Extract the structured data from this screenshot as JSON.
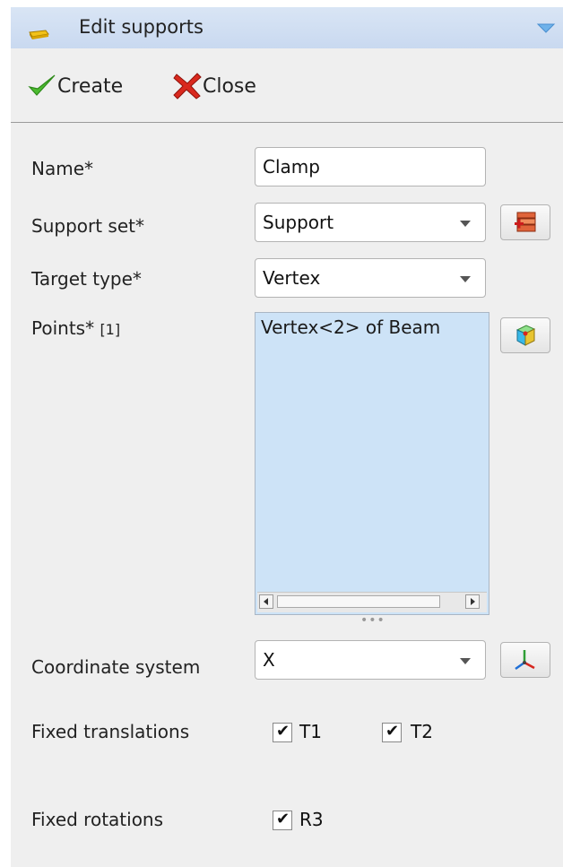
{
  "titlebar": {
    "title": "Edit supports"
  },
  "toolbar": {
    "create_label": "Create",
    "close_label": "Close"
  },
  "form": {
    "name": {
      "label": "Name*",
      "value": "Clamp"
    },
    "support_set": {
      "label": "Support set*",
      "value": "Support"
    },
    "target_type": {
      "label": "Target type*",
      "value": "Vertex"
    },
    "points": {
      "label": "Points*",
      "count": "[1]",
      "items": [
        "Vertex<2> of Beam"
      ]
    },
    "coordinate_system": {
      "label": "Coordinate system",
      "value": "X"
    },
    "fixed_translations": {
      "label": "Fixed translations",
      "options": [
        {
          "label": "T1",
          "checked": true
        },
        {
          "label": "T2",
          "checked": true
        }
      ]
    },
    "fixed_rotations": {
      "label": "Fixed rotations",
      "options": [
        {
          "label": "R3",
          "checked": true
        }
      ]
    }
  },
  "icons": {
    "title": "support-icon",
    "collapse": "collapse-triangle-icon",
    "create": "checkmark-icon",
    "close": "red-x-icon",
    "support_set_button": "new-support-set-icon",
    "points_button": "select-vertex-icon",
    "coordinate_button": "coordinate-axes-icon"
  },
  "colors": {
    "titlebar": "#d2e1f4",
    "panel": "#efefef",
    "list_selection": "#cde3f7",
    "create_icon": "#3da62b",
    "close_icon": "#d4261c"
  }
}
